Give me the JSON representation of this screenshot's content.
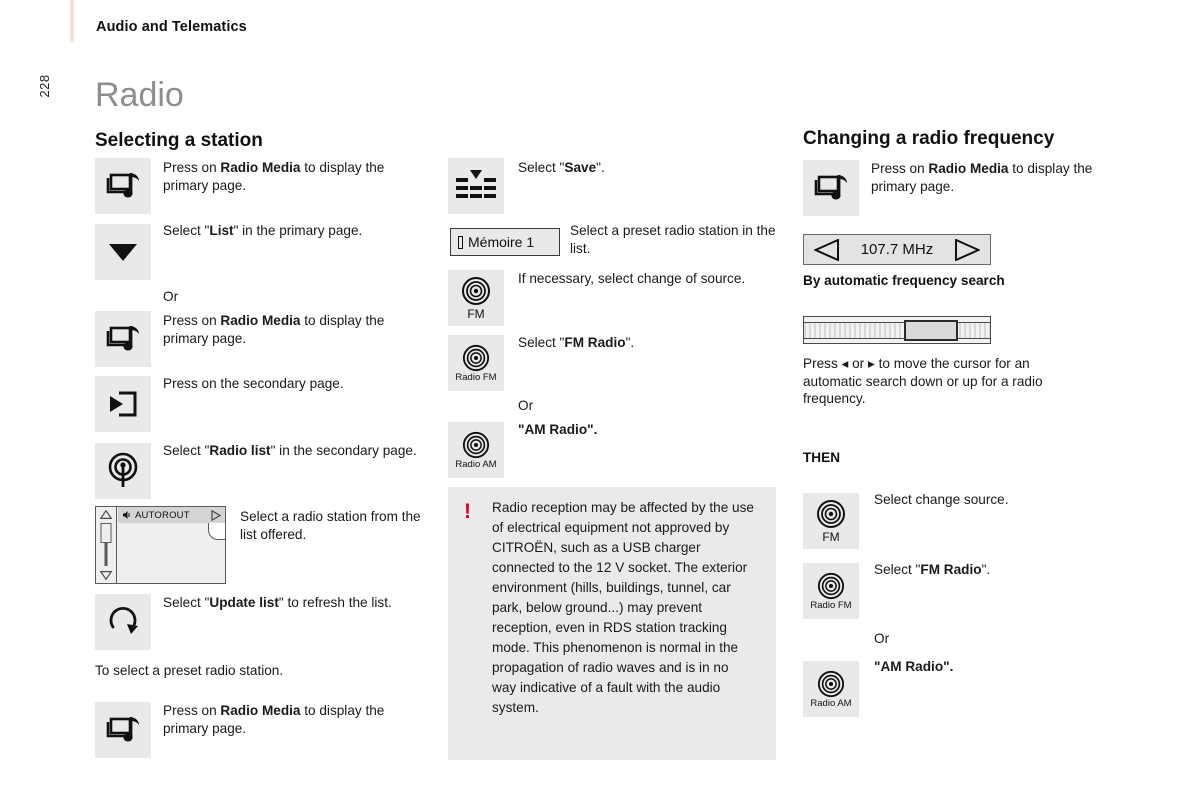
{
  "header": {
    "breadcrumb": "Audio and Telematics",
    "page_number": "228"
  },
  "doc_title": "Radio",
  "sections": {
    "selecting": "Selecting a station",
    "changing": "Changing a radio frequency"
  },
  "col1": {
    "step1_text_pre": "Press on ",
    "step1_text_bold": "Radio Media",
    "step1_text_post": " to display the primary page.",
    "step2_pre": "Select \"",
    "step2_bold": "List",
    "step2_post": "\" in the primary page.",
    "or1": "Or",
    "step3_pre": "Press on ",
    "step3_bold": "Radio Media",
    "step3_post": " to display the primary page.",
    "step4": "Press on the secondary page.",
    "step5_pre": "Select \"",
    "step5_bold": "Radio list",
    "step5_post": "\" in the secondary page.",
    "step6": "Select a radio station from the list offered.",
    "step7_pre": "Select \"",
    "step7_bold": "Update list",
    "step7_post": "\" to refresh the list.",
    "preset_note": "To select a preset radio station.",
    "step8_pre": "Press on ",
    "step8_bold": "Radio Media",
    "step8_post": " to display the primary page.",
    "autorout_station": "AUTOROUT"
  },
  "col2": {
    "save_pre": "Select \"",
    "save_bold": "Save",
    "save_post": "\".",
    "memoire_label": "Mémoire 1",
    "preset_text": "Select a preset radio station in the list.",
    "source_text": "If necessary, select change of source.",
    "fm_pre": "Select \"",
    "fm_bold": "FM Radio",
    "fm_post": "\".",
    "or": "Or",
    "am_bold": "\"AM Radio\".",
    "icon_fm": "FM",
    "icon_radio_fm": "Radio FM",
    "icon_radio_am": "Radio AM",
    "warning": "Radio reception may be affected by the use of electrical equipment not approved by CITROËN, such as a USB charger connected to the 12 V socket. The exterior environment (hills, buildings, tunnel, car park, below ground...) may prevent reception, even in RDS station tracking mode. This phenomenon is normal in the propagation of radio waves and is in no way indicative of a fault with the audio system.",
    "warning_icon": "!"
  },
  "col3": {
    "step1_pre": "Press on ",
    "step1_bold": "Radio Media",
    "step1_post": " to display the primary page.",
    "frequency": "107.7 MHz",
    "auto_search_head": "By automatic frequency search",
    "tuner_text": "Press ◂ or ▸ to move the cursor for an automatic search down or up for a radio frequency.",
    "then": "THEN",
    "change_source": "Select change source.",
    "fm_pre": "Select \"",
    "fm_bold": "FM Radio",
    "fm_post": "\".",
    "or": "Or",
    "am_bold": "\"AM Radio\".",
    "icon_fm": "FM",
    "icon_radio_fm": "Radio FM",
    "icon_radio_am": "Radio AM"
  },
  "colors": {
    "accent_rule": "#efe6d2",
    "title_gray": "#8e8e8e",
    "icon_bg": "#e9e9e9",
    "warning_red": "#e2001a",
    "warning_bg": "#eaeaea"
  }
}
